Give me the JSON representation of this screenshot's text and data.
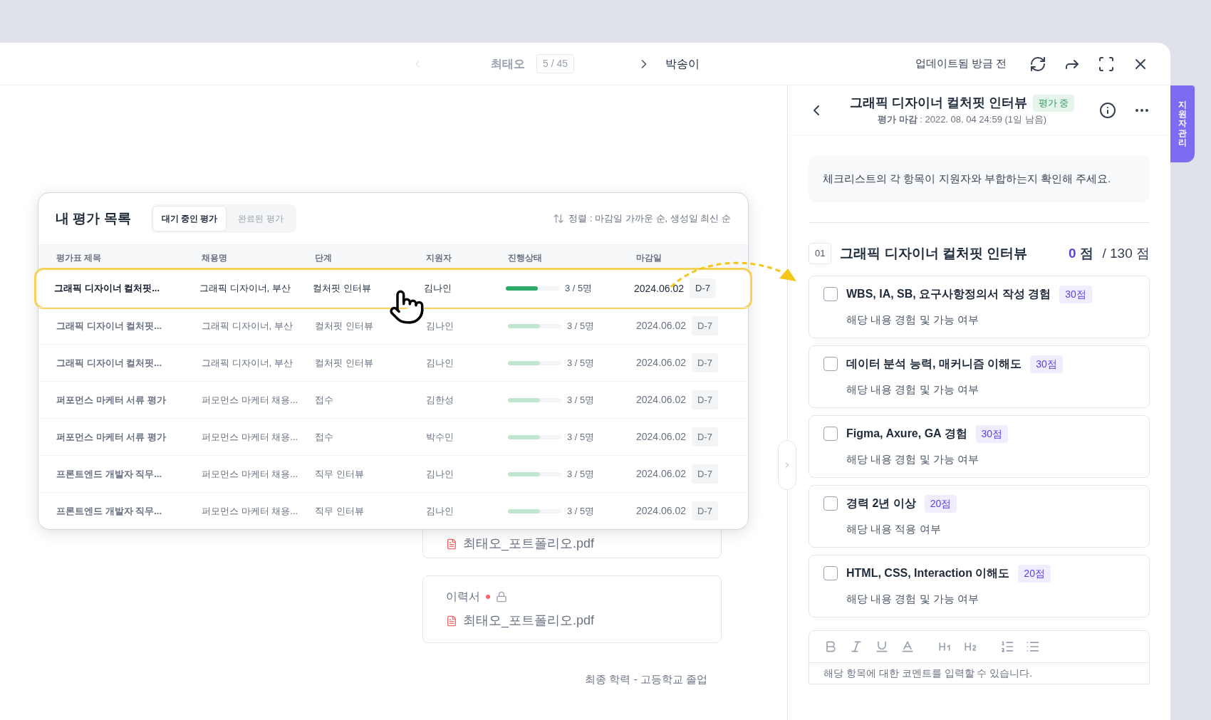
{
  "topbar": {
    "prev_name": "최태오",
    "position": "5 / 45",
    "next_name": "박송이",
    "updated": "업데이트됨 방금 전"
  },
  "evaluation_list": {
    "title": "내 평가 목록",
    "tabs": [
      {
        "label": "대기 중인 평가",
        "selected": true
      },
      {
        "label": "완료된 평가",
        "selected": false
      }
    ],
    "sort": "정렬 : 마감일 가까운 순, 생성일 최신 순",
    "columns": [
      "평가표 제목",
      "채용명",
      "단계",
      "지원자",
      "진행상태",
      "마감일"
    ],
    "rows": [
      {
        "title": "그래픽 디자이너 컬처핏...",
        "job": "그래픽 디자이너, 부산",
        "stage": "컬처핏 인터뷰",
        "applicant": "김나인",
        "level": 0.6,
        "progress": "3 / 5명",
        "deadline": "2024.06.02",
        "dday": "D-7",
        "selected": true
      },
      {
        "title": "그래픽 디자이너 컬처핏...",
        "job": "그래픽 디자이너, 부산",
        "stage": "컬처핏 인터뷰",
        "applicant": "김나인",
        "level": 0.6,
        "progress": "3 / 5명",
        "deadline": "2024.06.02",
        "dday": "D-7",
        "selected": false
      },
      {
        "title": "그래픽 디자이너 컬처핏...",
        "job": "그래픽 디자이너, 부산",
        "stage": "컬처핏 인터뷰",
        "applicant": "김나인",
        "level": 0.6,
        "progress": "3 / 5명",
        "deadline": "2024.06.02",
        "dday": "D-7",
        "selected": false
      },
      {
        "title": "퍼포먼스 마케터 서류 평가",
        "job": "퍼모먼스 마케터 채용...",
        "stage": "접수",
        "applicant": "김한성",
        "level": 0.6,
        "progress": "3 / 5명",
        "deadline": "2024.06.02",
        "dday": "D-7",
        "selected": false
      },
      {
        "title": "퍼포먼스 마케터 서류 평가",
        "job": "퍼모먼스 마케터 채용...",
        "stage": "접수",
        "applicant": "박수민",
        "level": 0.6,
        "progress": "3 / 5명",
        "deadline": "2024.06.02",
        "dday": "D-7",
        "selected": false
      },
      {
        "title": "프론트엔드 개발자 직무...",
        "job": "퍼모먼스 마케터 채용...",
        "stage": "직무 인터뷰",
        "applicant": "김나인",
        "level": 0.6,
        "progress": "3 / 5명",
        "deadline": "2024.06.02",
        "dday": "D-7",
        "selected": false
      },
      {
        "title": "프론트엔드 개발자 직무...",
        "job": "퍼모먼스 마케터 채용...",
        "stage": "직무 인터뷰",
        "applicant": "김나인",
        "level": 0.6,
        "progress": "3 / 5명",
        "deadline": "2024.06.02",
        "dday": "D-7",
        "selected": false
      }
    ]
  },
  "background": {
    "file": "최태오_포트폴리오.pdf",
    "resume_label": "이력서",
    "resume_file": "최태오_포트폴리오.pdf",
    "education": "최종 학력 - 고등학교 졸업"
  },
  "panel": {
    "title": "그래픽 디자이너 컬처핏 인터뷰",
    "status": "평가 중",
    "deadline": "**평가 마감** : 2022. 08. 04 24:59 (1일 남음)",
    "side_tab": "지원자 관리",
    "notice": "체크리스트의 각 항목이 지원자와 부합하는지 확인해 주세요.",
    "section": {
      "number": "01",
      "title": "그래픽 디자이너 컬처핏 인터뷰",
      "score": "0",
      "score_unit": "점",
      "total": "/ 130 점"
    },
    "checklist": [
      {
        "title": "WBS, IA, SB, 요구사항정의서 작성 경험",
        "points": "30점",
        "description": "해당 내용 경험 및 가능 여부",
        "checked": false
      },
      {
        "title": "데이터 분석 능력, 매커니즘 이해도",
        "points": "30점",
        "description": "해당 내용 경험 및 가능 여부",
        "checked": false
      },
      {
        "title": "Figma, Axure, GA 경험",
        "points": "30점",
        "description": "해당 내용 경험 및 가능 여부",
        "checked": false
      },
      {
        "title": "경력 2년 이상",
        "points": "20점",
        "description": "해당 내용 적용 여부",
        "checked": false
      },
      {
        "title": "HTML, CSS, Interaction 이해도",
        "points": "20점",
        "description": "해당 내용 경험 및 가능 여부",
        "checked": false
      }
    ],
    "comment_placeholder": "해당 항목에 대한 코멘트를 입력할 수 있습니다."
  }
}
